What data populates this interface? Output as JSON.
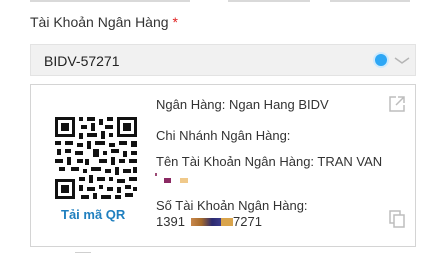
{
  "form": {
    "bank_account_label": "Tài Khoản Ngân Hàng",
    "required_mark": "*",
    "selected_account": "BIDV-57271"
  },
  "card": {
    "bank_line": "Ngân Hàng: Ngan Hang BIDV",
    "branch_line": "Chi Nhánh Ngân Hàng:",
    "name_line": "Tên Tài Khoản Ngân Hàng: TRAN VAN",
    "account_label": "Số Tài Khoản Ngân Hàng:",
    "account_start": "1391",
    "account_end": "7271",
    "qr_download": "Tải mã QR"
  },
  "icons": {
    "status": "status-dot-icon",
    "dropdown": "chevron-down-icon",
    "open": "external-link-icon",
    "copy": "copy-icon"
  },
  "colors": {
    "accent": "#2ea7f5",
    "link": "#1f7fbf",
    "required": "#e02020"
  }
}
